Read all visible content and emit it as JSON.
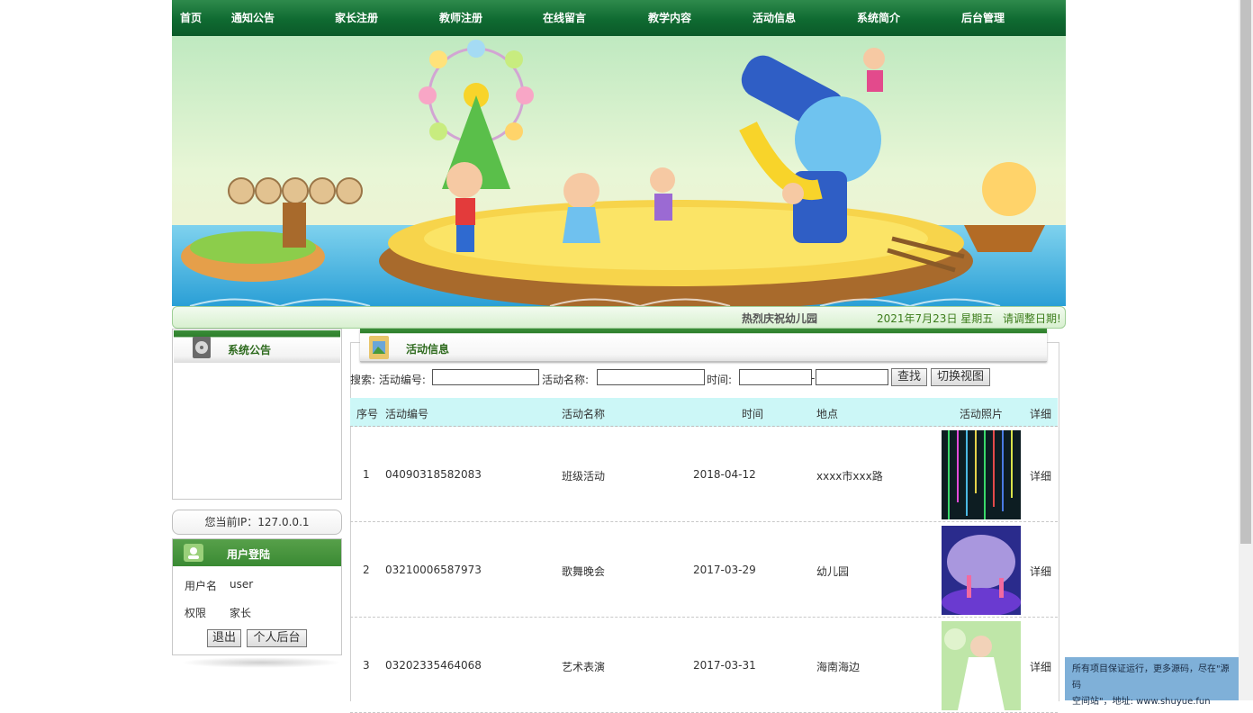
{
  "nav": [
    "首页",
    "通知公告",
    "家长注册",
    "教师注册",
    "在线留言",
    "教学内容",
    "活动信息",
    "系统简介",
    "后台管理"
  ],
  "marquee": {
    "message": "热烈庆祝幼儿园",
    "date": "2021年7月23日 星期五",
    "hint": "请调整日期!"
  },
  "notice": {
    "title": "系统公告"
  },
  "ip": {
    "text": "您当前IP：127.0.0.1"
  },
  "login": {
    "title": "用户登陆",
    "username_label": "用户名",
    "username": "user",
    "role_label": "权限",
    "role": "家长",
    "logout_label": "退出",
    "backend_label": "个人后台"
  },
  "main": {
    "title": "活动信息",
    "search": {
      "label": "搜索: 活动编号:",
      "name_label": "活动名称:",
      "time_label": "时间:",
      "dash": "-",
      "find_label": "查找",
      "switch_label": "切换视图"
    },
    "columns": [
      "序号",
      "活动编号",
      "活动名称",
      "时间",
      "地点",
      "活动照片",
      "详细"
    ],
    "rows": [
      {
        "idx": "1",
        "code": "04090318582083",
        "name": "班级活动",
        "time": "2018-04-12",
        "place": "xxxx市xxx路",
        "detail": "详细"
      },
      {
        "idx": "2",
        "code": "03210006587973",
        "name": "歌舞晚会",
        "time": "2017-03-29",
        "place": "幼儿园",
        "detail": "详细"
      },
      {
        "idx": "3",
        "code": "03202335464068",
        "name": "艺术表演",
        "time": "2017-03-31",
        "place": "海南海边",
        "detail": "详细"
      }
    ]
  },
  "float_note": {
    "line1": "所有项目保证运行，更多源码，尽在\"源码",
    "line2": "空间站\"，地址: www.shuyue.fun"
  },
  "colors": {
    "nav_green": "#0f6a31",
    "header_cyan": "#ccf7f7",
    "note_blue": "#7fb0d8"
  }
}
